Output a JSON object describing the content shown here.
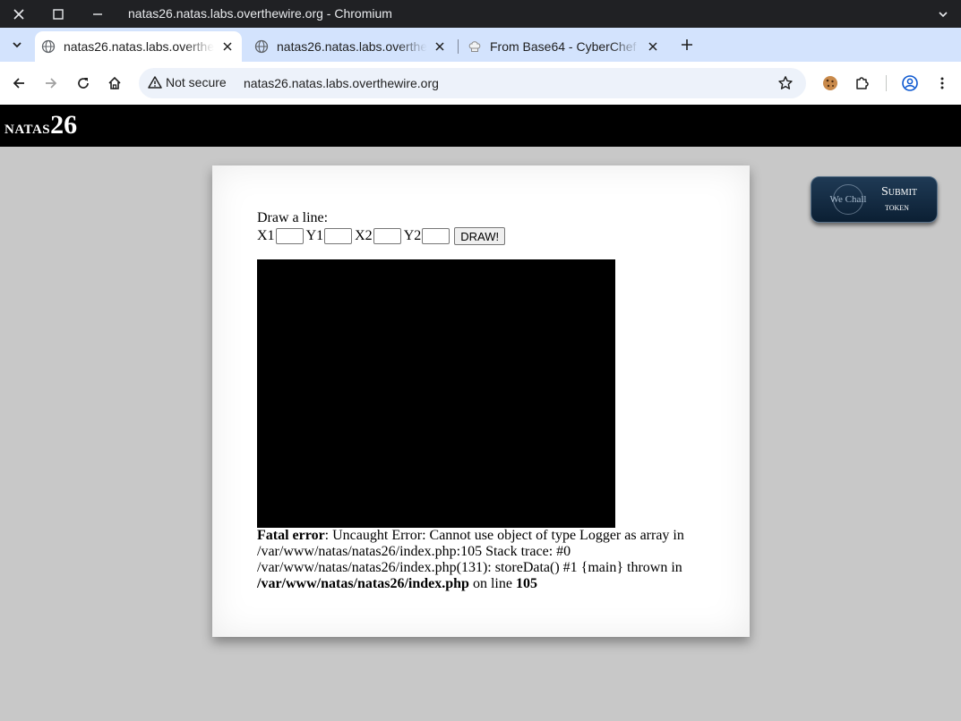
{
  "window": {
    "title": "natas26.natas.labs.overthewire.org - Chromium"
  },
  "tabs": [
    {
      "label": "natas26.natas.labs.overthewire.org",
      "active": true,
      "icon": "globe-icon"
    },
    {
      "label": "natas26.natas.labs.overthewire.org",
      "active": false,
      "icon": "globe-icon"
    },
    {
      "label": "From Base64 - CyberChef",
      "active": false,
      "icon": "chef-hat-icon"
    }
  ],
  "toolbar": {
    "security_label": "Not secure",
    "url": "natas26.natas.labs.overthewire.org"
  },
  "page": {
    "logo_small": "natas",
    "logo_number": "26",
    "draw_label": "Draw a line:",
    "coords": {
      "x1_label": "X1",
      "y1_label": "Y1",
      "x2_label": "X2",
      "y2_label": "Y2",
      "x1_value": "",
      "y1_value": "",
      "x2_value": "",
      "y2_value": ""
    },
    "draw_button": "DRAW!",
    "error": {
      "prefix": "Fatal error",
      "message": ": Uncaught Error: Cannot use object of type Logger as array in /var/www/natas/natas26/index.php:105 Stack trace: #0 /var/www/natas/natas26/index.php(131): storeData() #1 {main} thrown in ",
      "file": "/var/www/natas/natas26/index.php",
      "on_line": " on line ",
      "line": "105"
    },
    "submit_token": {
      "logo_text": "We Chall",
      "line1": "Submit",
      "line2": "token"
    }
  },
  "colors": {
    "page_bg": "#c8c8c8",
    "header_bg": "#000000",
    "tabstrip_bg": "#d3e3fd",
    "omnibox_bg": "#edf2fa"
  }
}
